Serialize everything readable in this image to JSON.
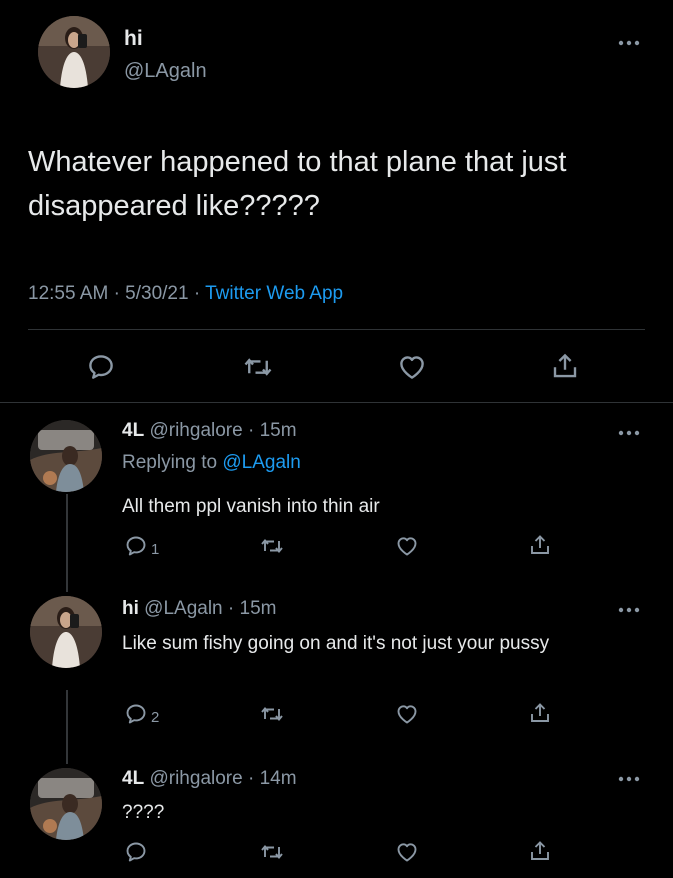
{
  "main_tweet": {
    "display_name": "hi",
    "handle": "@LAgaln",
    "text": "Whatever happened to that plane that just disappeared like?????",
    "time": "12:55 AM",
    "date": "5/30/21",
    "source": "Twitter Web App",
    "separator": "·"
  },
  "replies": [
    {
      "display_name": "4L",
      "handle": "@rihgalore",
      "time": "15m",
      "replying_to_label": "Replying to",
      "replying_to_handle": "@LAgaln",
      "text": "All them ppl vanish into thin air",
      "reply_count": "1"
    },
    {
      "display_name": "hi",
      "handle": "@LAgaln",
      "time": "15m",
      "text": "Like sum fishy going on and it's not just your pussy",
      "reply_count": "2"
    },
    {
      "display_name": "4L",
      "handle": "@rihgalore",
      "time": "14m",
      "text": "????",
      "reply_count": ""
    }
  ],
  "colors": {
    "background": "#000000",
    "text": "#e7e9ea",
    "muted": "#8b98a5",
    "accent": "#1d9bf0",
    "divider": "#2f3336"
  },
  "icons": [
    "reply-icon",
    "retweet-icon",
    "like-icon",
    "share-icon",
    "more-icon"
  ]
}
